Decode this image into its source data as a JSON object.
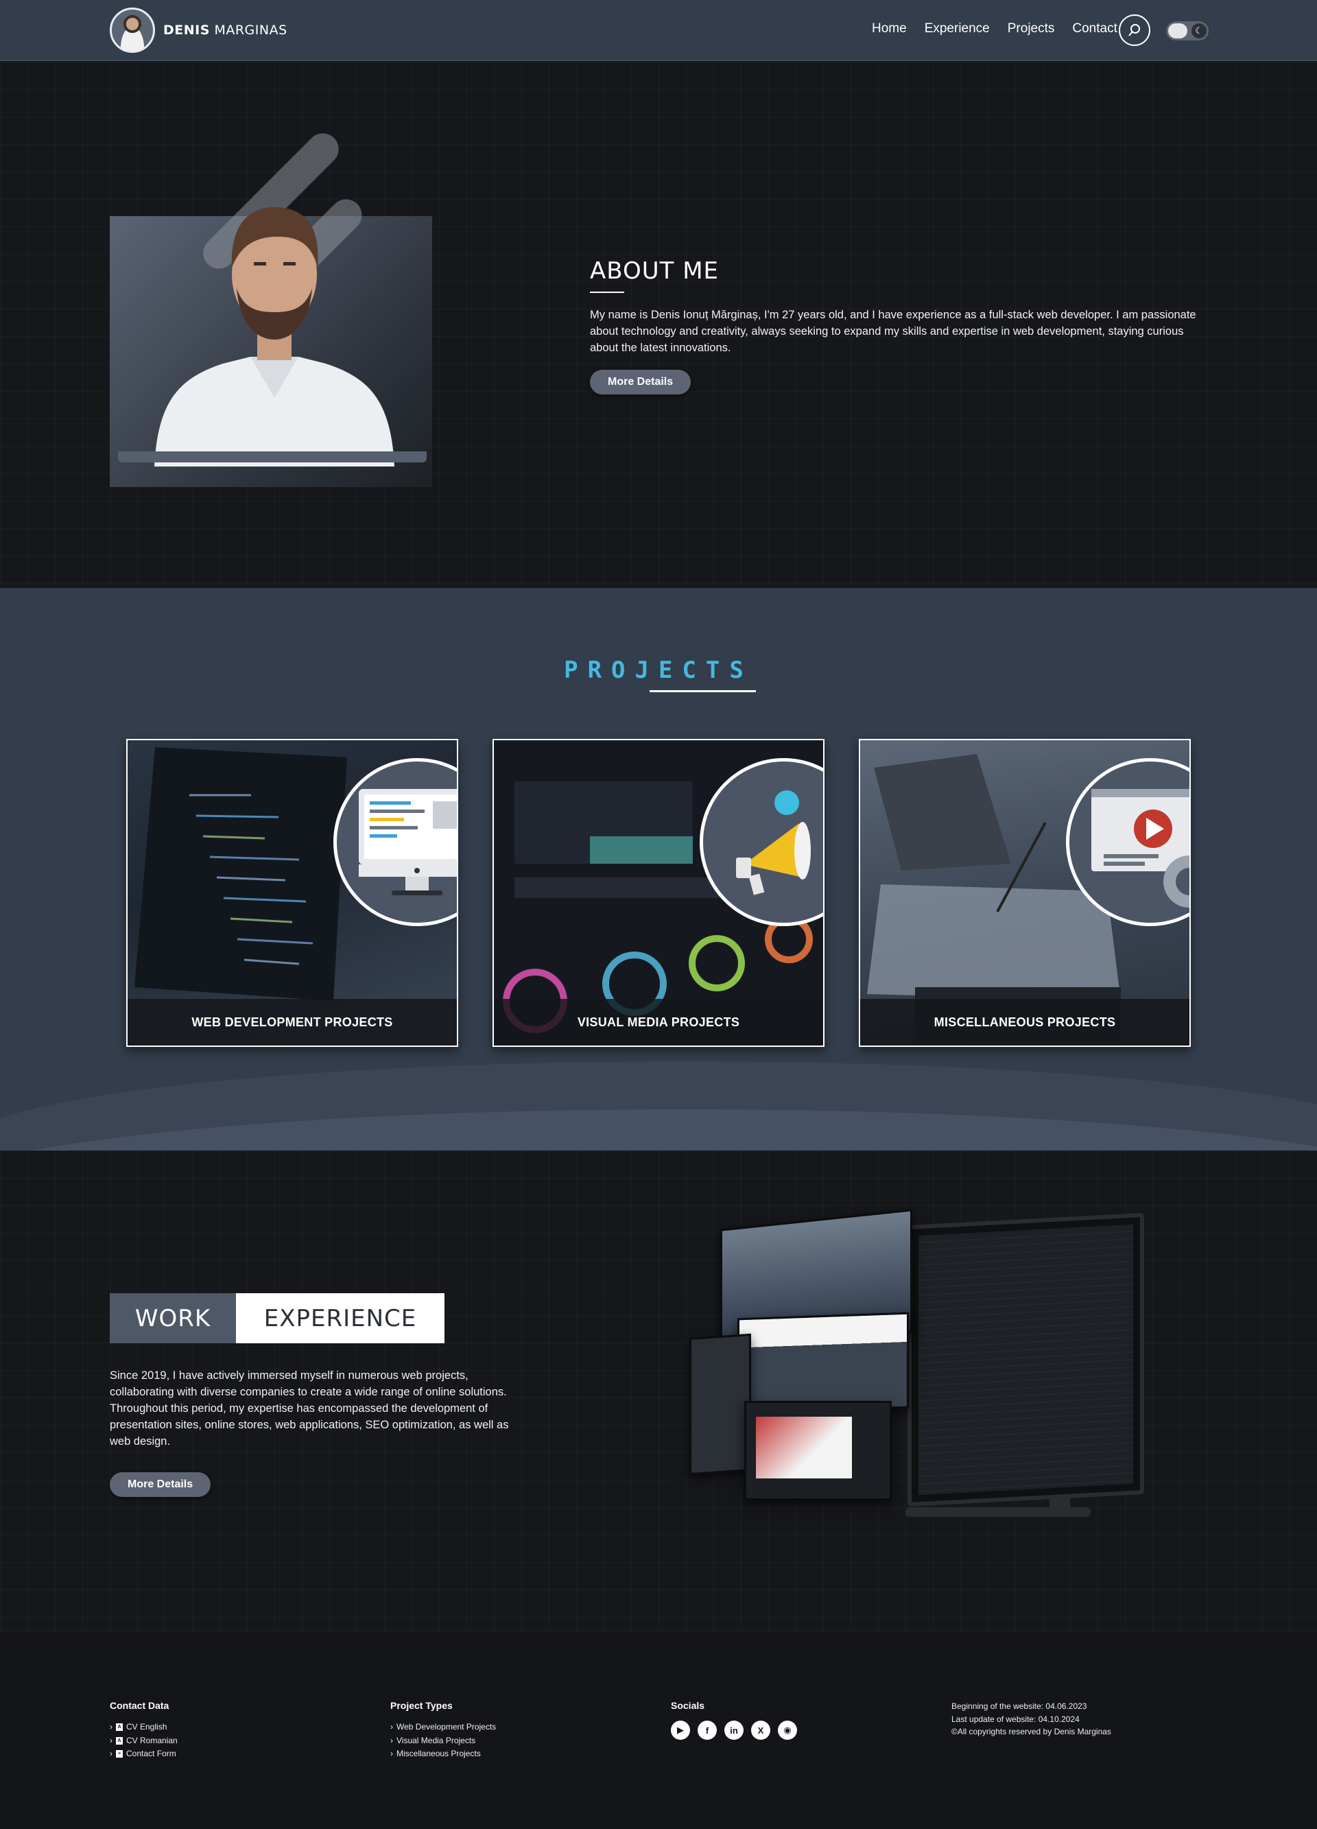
{
  "nav": {
    "brand_first": "DENIS",
    "brand_last": "MARGINAS",
    "menu": [
      "Home",
      "Experience",
      "Projects",
      "Contact"
    ]
  },
  "about": {
    "title": "About Me",
    "text": "My name is Denis Ionuț Mărginaș, I'm 27 years old, and I have experience as a full-stack web developer. I am passionate about technology and creativity, always seeking to expand my skills and expertise in web development, staying curious about the latest innovations.",
    "button": "More Details"
  },
  "projects": {
    "title": "PROJECTS",
    "cards": [
      {
        "label": "WEB DEVELOPMENT PROJECTS",
        "icon": "monitor-code-icon"
      },
      {
        "label": "VISUAL MEDIA PROJECTS",
        "icon": "megaphone-icon"
      },
      {
        "label": "MISCELLANEOUS PROJECTS",
        "icon": "video-player-icon"
      }
    ]
  },
  "work": {
    "title_1": "WORK",
    "title_2": "EXPERIENCE",
    "text": "Since 2019, I have actively immersed myself in numerous web projects, collaborating with diverse companies to create a wide range of online solutions. Throughout this period, my expertise has encompassed the development of presentation sites, online stores, web applications, SEO optimization, as well as web design.",
    "button": "More Details"
  },
  "footer": {
    "contact": {
      "title": "Contact Data",
      "items": [
        "CV English",
        "CV Romanian",
        "Contact Form"
      ]
    },
    "types": {
      "title": "Project Types",
      "items": [
        "Web Development Projects",
        "Visual Media Projects",
        "Miscellaneous Projects"
      ]
    },
    "socials": {
      "title": "Socials",
      "icons": [
        "youtube-icon",
        "facebook-icon",
        "linkedin-icon",
        "x-icon",
        "github-icon"
      ]
    },
    "meta": {
      "start": "Beginning of the website: 04.06.2023",
      "update": "Last update of website: 04.10.2024",
      "copyright": "©All copyrights reserved by Denis Marginas"
    }
  }
}
